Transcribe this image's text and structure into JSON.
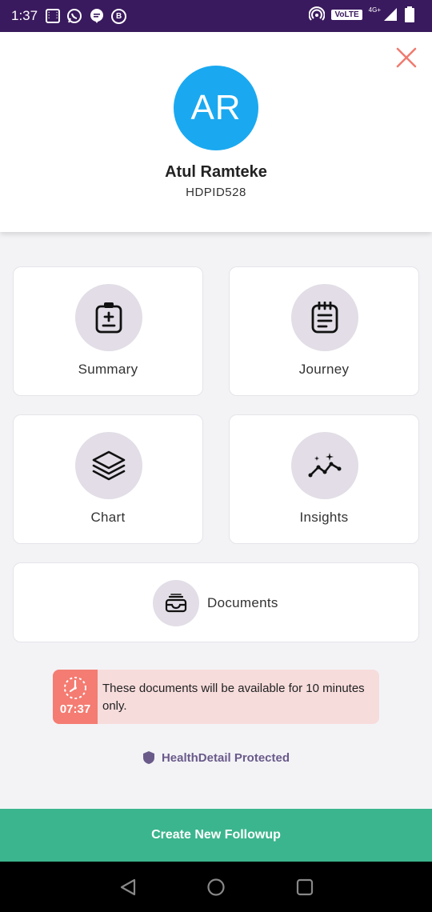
{
  "status_bar": {
    "time": "1:37",
    "volte": "VoLTE",
    "network": "4G+"
  },
  "header": {
    "avatar_initials": "AR",
    "name": "Atul Ramteke",
    "patient_id": "HDPID528"
  },
  "tiles": {
    "summary": "Summary",
    "journey": "Journey",
    "chart": "Chart",
    "insights": "Insights",
    "documents": "Documents"
  },
  "notice": {
    "time": "07:37",
    "text": "These documents will be available for 10 minutes only."
  },
  "protected_text": "HealthDetail Protected",
  "followup_button": "Create New Followup",
  "colors": {
    "status_bar": "#3a1a5e",
    "avatar": "#1aa9f0",
    "close": "#f07a6e",
    "icon_circle": "#e2dde6",
    "timer": "#f47c72",
    "notice_bg": "#f7dcdc",
    "primary_button": "#3bb58d"
  }
}
